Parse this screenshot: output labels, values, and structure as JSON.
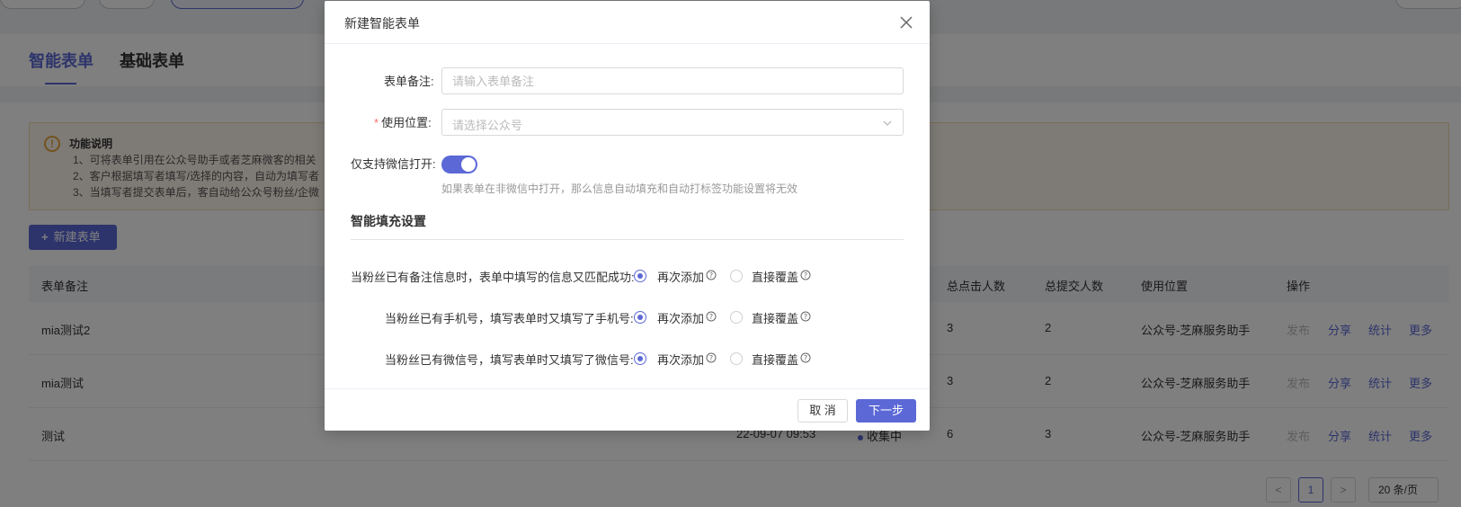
{
  "tabs": [
    {
      "label": "智能表单",
      "active": true
    },
    {
      "label": "基础表单",
      "active": false
    }
  ],
  "notice": {
    "title": "功能说明",
    "lines": [
      "1、可将表单引用在公众号助手或者芝麻微客的相关",
      "2、客户根据填写者填写/选择的内容，自动为填写者",
      "3、当填写者提交表单后，客自动给公众号粉丝/企微"
    ]
  },
  "new_button_label": "新建表单",
  "table": {
    "headers": {
      "remark": "表单备注",
      "clicks": "总点击人数",
      "submits": "总提交人数",
      "location": "使用位置",
      "actions": "操作"
    },
    "rows": [
      {
        "remark": "mia测试2",
        "time": "",
        "status": "",
        "clicks": "3",
        "submits": "2",
        "location": "公众号-芝麻服务助手"
      },
      {
        "remark": "mia测试",
        "time": "",
        "status": "",
        "clicks": "3",
        "submits": "2",
        "location": "公众号-芝麻服务助手"
      },
      {
        "remark": "测试",
        "time": "22-09-07 09:53",
        "status": "收集中",
        "clicks": "6",
        "submits": "3",
        "location": "公众号-芝麻服务助手"
      }
    ],
    "actions": {
      "publish": "发布",
      "share": "分享",
      "stats": "统计",
      "more": "更多"
    }
  },
  "pagination": {
    "current": "1",
    "prev": "<",
    "next": ">",
    "page_size": "20 条/页"
  },
  "modal": {
    "title": "新建智能表单",
    "remark_label": "表单备注:",
    "remark_placeholder": "请输入表单备注",
    "location_label": "使用位置:",
    "location_placeholder": "请选择公众号",
    "wechat_only_label": "仅支持微信打开:",
    "wechat_only_hint": "如果表单在非微信中打开，那么信息自动填充和自动打标签功能设置将无效",
    "section_title": "智能填充设置",
    "rules": [
      {
        "label": "当粉丝已有备注信息时，表单中填写的信息又匹配成功:"
      },
      {
        "label": "当粉丝已有手机号，填写表单时又填写了手机号:"
      },
      {
        "label": "当粉丝已有微信号，填写表单时又填写了微信号:"
      }
    ],
    "option_add": "再次添加",
    "option_overwrite": "直接覆盖",
    "cancel_label": "取 消",
    "next_label": "下一步"
  },
  "colors": {
    "primary": "#5b68d6",
    "warning": "#e6a23c",
    "required": "#f56c6c"
  }
}
